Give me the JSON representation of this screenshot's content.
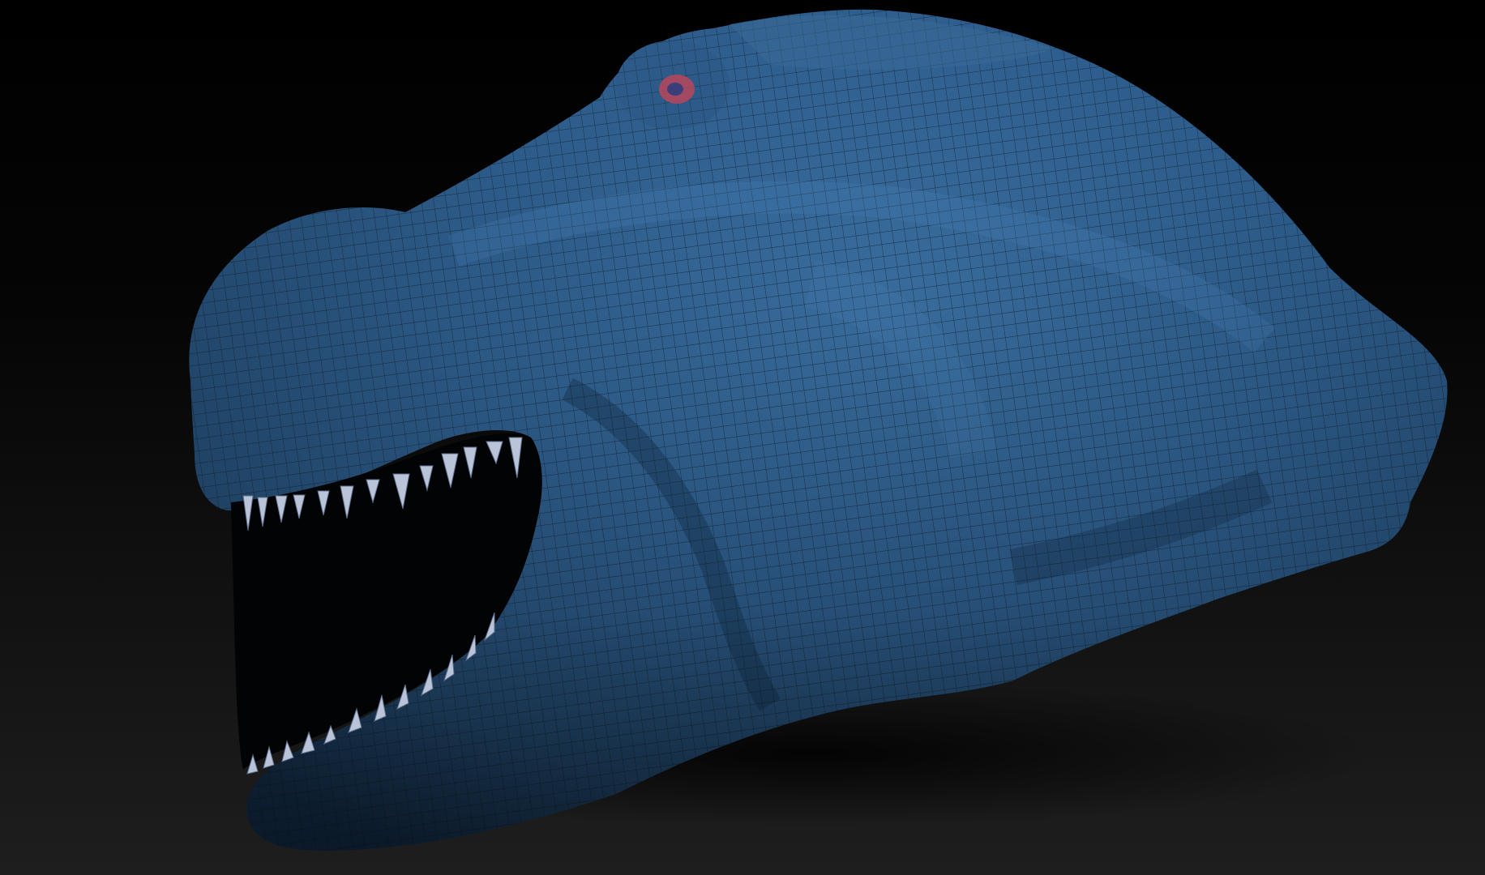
{
  "viewport": {
    "background_top": "#000000",
    "background_bottom": "#1e1e1e"
  },
  "model": {
    "subject": "creature-head-sculpt",
    "material_color": "#2f5f8f",
    "wireframe_visible": true,
    "wire_color": "#0d1c2a",
    "teeth_color": "#b9c4d8",
    "eye_highlight_color": "#b8465a"
  }
}
